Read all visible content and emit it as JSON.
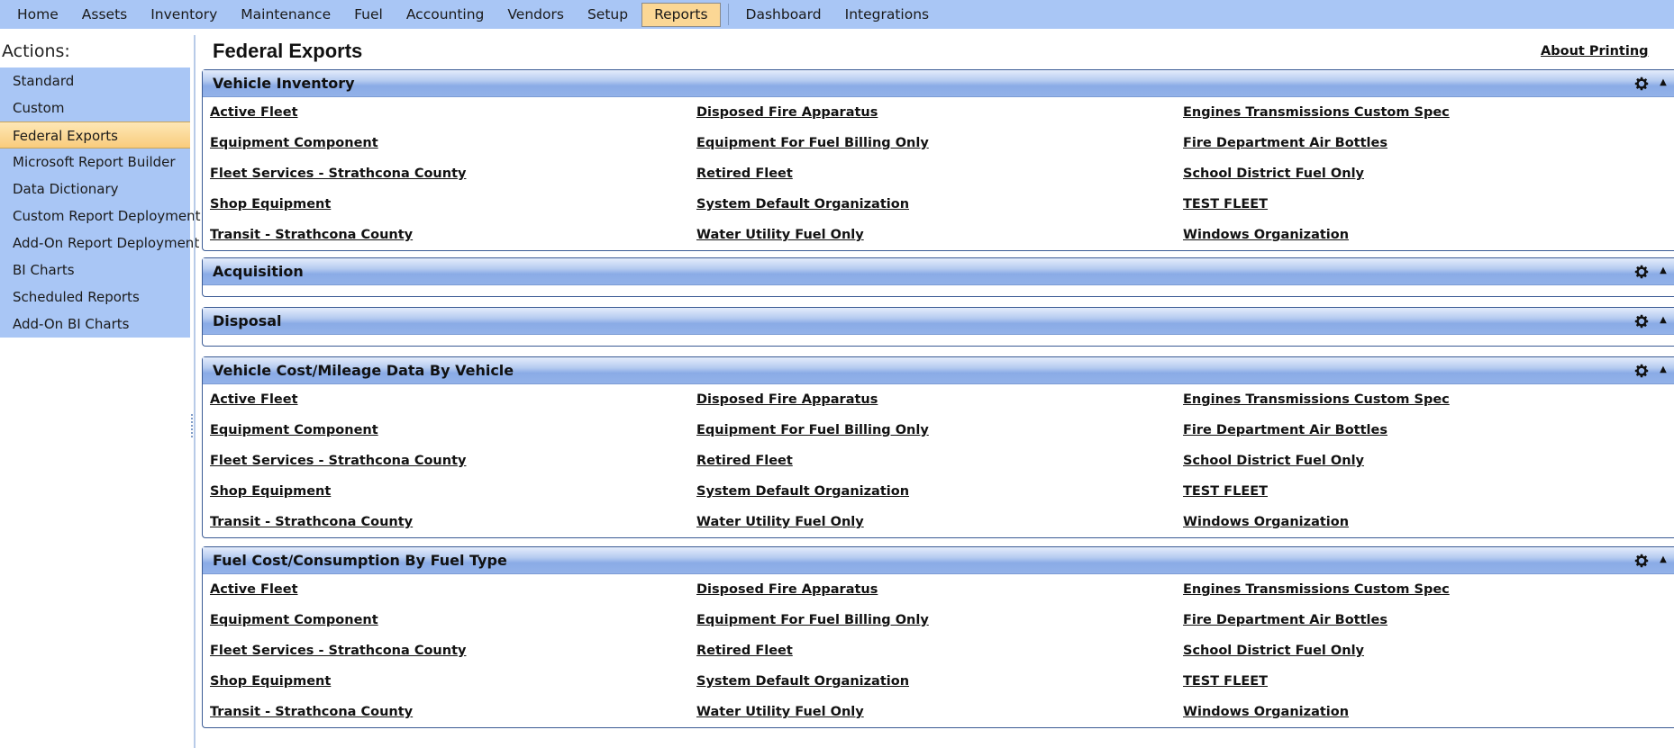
{
  "menu": {
    "items": [
      {
        "label": "Home",
        "active": false
      },
      {
        "label": "Assets",
        "active": false
      },
      {
        "label": "Inventory",
        "active": false
      },
      {
        "label": "Maintenance",
        "active": false
      },
      {
        "label": "Fuel",
        "active": false
      },
      {
        "label": "Accounting",
        "active": false
      },
      {
        "label": "Vendors",
        "active": false
      },
      {
        "label": "Setup",
        "active": false
      },
      {
        "label": "Reports",
        "active": true
      },
      {
        "label": "Dashboard",
        "active": false
      },
      {
        "label": "Integrations",
        "active": false
      }
    ]
  },
  "sidebar": {
    "title": "Actions:",
    "items": [
      {
        "label": "Standard",
        "active": false
      },
      {
        "label": "Custom",
        "active": false
      },
      {
        "label": "Federal Exports",
        "active": true
      },
      {
        "label": "Microsoft Report Builder",
        "active": false
      },
      {
        "label": "Data Dictionary",
        "active": false
      },
      {
        "label": "Custom Report Deployment",
        "active": false
      },
      {
        "label": "Add-On Report Deployment",
        "active": false
      },
      {
        "label": "BI Charts",
        "active": false
      },
      {
        "label": "Scheduled Reports",
        "active": false
      },
      {
        "label": "Add-On BI Charts",
        "active": false
      }
    ]
  },
  "main": {
    "title": "Federal Exports",
    "about_link": "About Printing",
    "panels": [
      {
        "title": "Vehicle Inventory",
        "reports": [
          "Active Fleet",
          "Disposed Fire Apparatus",
          "Engines Transmissions Custom Spec",
          "Equipment Component",
          "Equipment For Fuel Billing Only",
          "Fire Department Air Bottles",
          "Fleet Services - Strathcona County",
          "Retired Fleet",
          "School District Fuel Only",
          "Shop Equipment",
          "System Default Organization",
          "TEST FLEET",
          "Transit - Strathcona County",
          "Water Utility Fuel Only",
          "Windows Organization"
        ]
      },
      {
        "title": "Acquisition",
        "reports": []
      },
      {
        "title": "Disposal",
        "reports": []
      },
      {
        "title": "Vehicle Cost/Mileage Data By Vehicle",
        "reports": [
          "Active Fleet",
          "Disposed Fire Apparatus",
          "Engines Transmissions Custom Spec",
          "Equipment Component",
          "Equipment For Fuel Billing Only",
          "Fire Department Air Bottles",
          "Fleet Services - Strathcona County",
          "Retired Fleet",
          "School District Fuel Only",
          "Shop Equipment",
          "System Default Organization",
          "TEST FLEET",
          "Transit - Strathcona County",
          "Water Utility Fuel Only",
          "Windows Organization"
        ]
      },
      {
        "title": "Fuel Cost/Consumption By Fuel Type",
        "reports": [
          "Active Fleet",
          "Disposed Fire Apparatus",
          "Engines Transmissions Custom Spec",
          "Equipment Component",
          "Equipment For Fuel Billing Only",
          "Fire Department Air Bottles",
          "Fleet Services - Strathcona County",
          "Retired Fleet",
          "School District Fuel Only",
          "Shop Equipment",
          "System Default Organization",
          "TEST FLEET",
          "Transit - Strathcona County",
          "Water Utility Fuel Only",
          "Windows Organization"
        ]
      }
    ]
  },
  "colors": {
    "menu_bg": "#a9c6f5",
    "active_tab": "#fbd795",
    "panel_header": "#93b2e9",
    "panel_border": "#3a5a94"
  },
  "icons": {
    "panel_settings": "gear-icon",
    "panel_collapse": "collapse-up-icon"
  }
}
